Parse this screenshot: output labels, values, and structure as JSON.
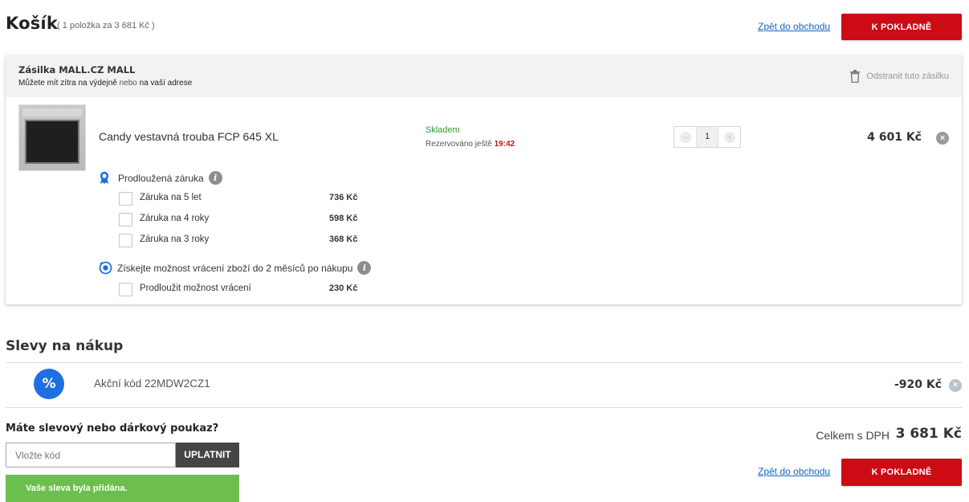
{
  "header": {
    "title": "Košík",
    "summary": "( 1 položka za 3 681 Kč )",
    "back_link": "Zpět do obchodu",
    "checkout_label": "K POKLADNĚ"
  },
  "shipment": {
    "name": "Zásilka MALL.CZ MALL",
    "note_prefix": "Můžete mít zítra na výdejně",
    "note_or": "nebo",
    "note_suffix": "na vaší adrese",
    "remove_label": "Odstranit tuto zásilku",
    "item": {
      "name": "Candy vestavná trouba FCP 645 XL",
      "stock": "Skladem",
      "reserved_prefix": "Rezervováno ještě",
      "reserved_time": "19:42",
      "quantity": "1",
      "price": "4 601 Kč"
    },
    "warranty": {
      "title": "Prodloužená záruka",
      "options": [
        {
          "label": "Záruka na 5 let",
          "price": "736 Kč"
        },
        {
          "label": "Záruka na 4 roky",
          "price": "598 Kč"
        },
        {
          "label": "Záruka na 3 roky",
          "price": "368 Kč"
        }
      ]
    },
    "returns": {
      "title": "Získejte možnost vrácení zboží do 2 měsíců po nákupu",
      "options": [
        {
          "label": "Prodloužit možnost vrácení",
          "price": "230 Kč"
        }
      ]
    }
  },
  "discounts": {
    "title": "Slevy na nákup",
    "badge": "%",
    "code_label": "Akční kód 22MDW2CZ1",
    "amount": "-920 Kč"
  },
  "voucher": {
    "question": "Máte slevový nebo dárkový poukaz?",
    "placeholder": "Vložte kód",
    "apply_label": "UPLATNIT",
    "success": "Vaše sleva byla přidána."
  },
  "totals": {
    "label": "Celkem s DPH",
    "value": "3 681 Kč"
  },
  "colors": {
    "checkout_red": "#cc0b14",
    "success_green": "#6cbf4c",
    "discount_blue": "#1e6fe0",
    "link_blue": "#1565c0"
  }
}
